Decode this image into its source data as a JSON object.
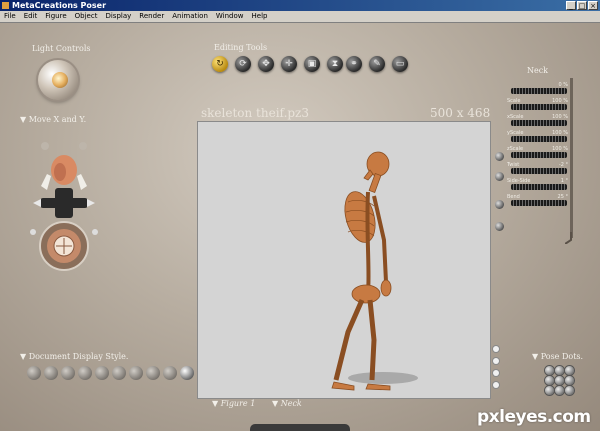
{
  "window": {
    "title": "MetaCreations Poser",
    "controls": [
      "_",
      "□",
      "×"
    ]
  },
  "menu": [
    "File",
    "Edit",
    "Figure",
    "Object",
    "Display",
    "Render",
    "Animation",
    "Window",
    "Help"
  ],
  "labels": {
    "light_controls": "Light Controls",
    "editing_tools": "Editing Tools",
    "move_xy": "Move X and Y.",
    "document_display_style": "Document Display Style.",
    "pose_dots": "Pose Dots."
  },
  "editing_tools": [
    {
      "icon": "rotate-icon",
      "glyph": "↻",
      "active": true
    },
    {
      "icon": "twist-icon",
      "glyph": "⟳",
      "active": false
    },
    {
      "icon": "translate-icon",
      "glyph": "✥",
      "active": false
    },
    {
      "icon": "translate-in-out-icon",
      "glyph": "✛",
      "active": false
    },
    {
      "icon": "scale-icon",
      "glyph": "▣",
      "active": false
    },
    {
      "icon": "taper-icon",
      "glyph": "⧗",
      "active": false
    },
    {
      "icon": "chain-break-icon",
      "glyph": "⚭",
      "active": false
    },
    {
      "icon": "color-icon",
      "glyph": "✎",
      "active": false
    },
    {
      "icon": "grouping-icon",
      "glyph": "▭",
      "active": false
    }
  ],
  "document": {
    "title": "skeleton theif.pz3",
    "size": "500 x 468"
  },
  "parameters": {
    "title": "Neck",
    "rows": [
      {
        "label": "",
        "value": "0 %"
      },
      {
        "label": "Scale",
        "value": "100 %"
      },
      {
        "label": "xScale",
        "value": "100 %"
      },
      {
        "label": "yScale",
        "value": "100 %"
      },
      {
        "label": "zScale",
        "value": "100 %"
      },
      {
        "label": "Twist",
        "value": "-2 °"
      },
      {
        "label": "Side-Side",
        "value": "1 °"
      },
      {
        "label": "Bend",
        "value": "25 °"
      }
    ]
  },
  "bottom": {
    "figure": "Figure 1",
    "part": "Neck"
  },
  "watermark": "pxleyes.com"
}
